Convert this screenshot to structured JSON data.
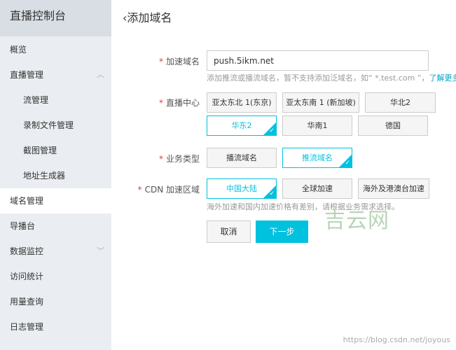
{
  "sidebar": {
    "title": "直播控制台",
    "items": [
      {
        "label": "概览"
      },
      {
        "label": "直播管理"
      },
      {
        "label": "流管理"
      },
      {
        "label": "录制文件管理"
      },
      {
        "label": "截图管理"
      },
      {
        "label": "地址生成器"
      },
      {
        "label": "域名管理"
      },
      {
        "label": "导播台"
      },
      {
        "label": "数据监控"
      },
      {
        "label": "访问统计"
      },
      {
        "label": "用量查询"
      },
      {
        "label": "日志管理"
      }
    ]
  },
  "page": {
    "title": "添加域名",
    "back_icon": "chevron-left"
  },
  "form": {
    "domain": {
      "label": "加速域名",
      "value": "push.5ikm.net",
      "hint": "添加推流或播流域名，暂不支持添加泛域名，如“ *.test.com ”，",
      "hint_link": "了解更多"
    },
    "center": {
      "label": "直播中心",
      "options": [
        "亚太东北 1(东京)",
        "亚太东南 1 (新加坡)",
        "华北2",
        "华东2",
        "华南1",
        "德国"
      ],
      "selected": "华东2"
    },
    "type": {
      "label": "业务类型",
      "options": [
        "播流域名",
        "推流域名"
      ],
      "selected": "推流域名"
    },
    "cdn": {
      "label": "CDN 加速区域",
      "options": [
        "中国大陆",
        "全球加速",
        "海外及港澳台加速"
      ],
      "selected": "中国大陆",
      "hint": "海外加速和国内加速价格有差别，请根据业务需求选择。"
    },
    "cancel": "取消",
    "next": "下一步"
  },
  "watermark": "吉云网",
  "source_url": "https://blog.csdn.net/joyous",
  "colors": {
    "accent": "#00c1de",
    "required": "#e4393c"
  }
}
